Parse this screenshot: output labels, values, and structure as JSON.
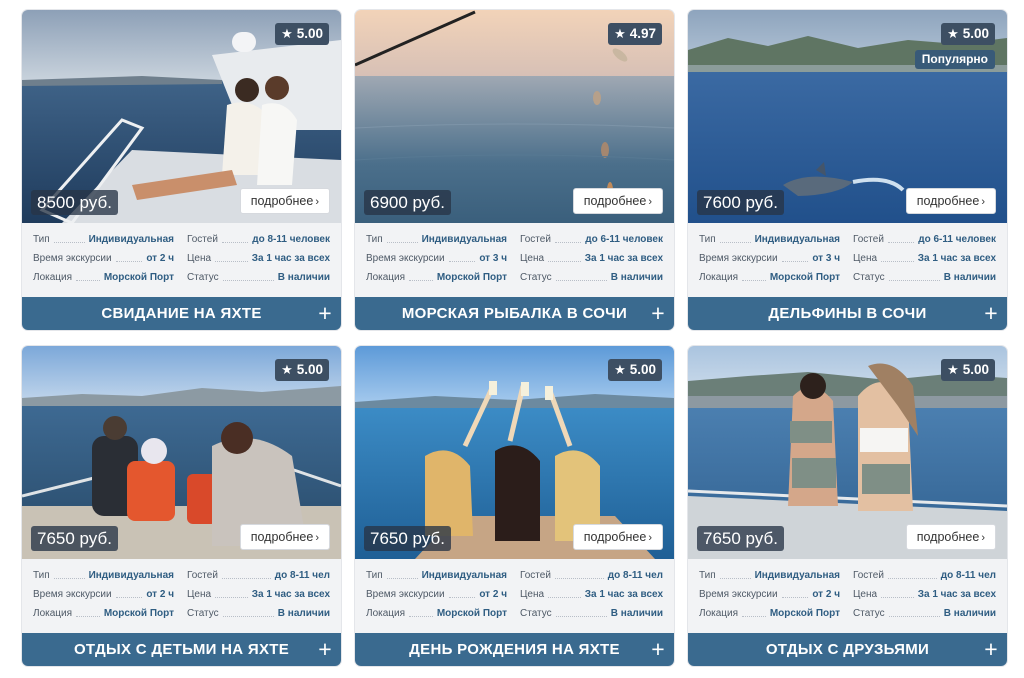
{
  "cards": [
    {
      "rating": "5.00",
      "badge": "",
      "price": "8500 руб.",
      "more": "подробнее",
      "title": "СВИДАНИЕ НА ЯХТЕ",
      "specs": {
        "type_label": "Тип",
        "type_value": "Индивидуальная",
        "guests_label": "Гостей",
        "guests_value": "до 8-11 человек",
        "time_label": "Время экскурсии",
        "time_value": "от 2 ч",
        "price_label": "Цена",
        "price_value": "За 1 час за всех",
        "loc_label": "Локация",
        "loc_value": "Морской Порт",
        "status_label": "Статус",
        "status_value": "В наличии"
      },
      "colors": {
        "sky": "#c8d2dc",
        "sea": "#2d4f78"
      }
    },
    {
      "rating": "4.97",
      "badge": "",
      "price": "6900 руб.",
      "more": "подробнее",
      "title": "МОРСКАЯ РЫБАЛКА В СОЧИ",
      "specs": {
        "type_label": "Тип",
        "type_value": "Индивидуальная",
        "guests_label": "Гостей",
        "guests_value": "до 6-11 человек",
        "time_label": "Время экскурсии",
        "time_value": "от 3 ч",
        "price_label": "Цена",
        "price_value": "За 1 час за всех",
        "loc_label": "Локация",
        "loc_value": "Морской Порт",
        "status_label": "Статус",
        "status_value": "В наличии"
      },
      "colors": {
        "sky": "#e8c8b0",
        "sea": "#5f7f95"
      }
    },
    {
      "rating": "5.00",
      "badge": "Популярно",
      "price": "7600 руб.",
      "more": "подробнее",
      "title": "ДЕЛЬФИНЫ В СОЧИ",
      "specs": {
        "type_label": "Тип",
        "type_value": "Индивидуальная",
        "guests_label": "Гостей",
        "guests_value": "до 6-11 человек",
        "time_label": "Время экскурсии",
        "time_value": "от 3 ч",
        "price_label": "Цена",
        "price_value": "За 1 час за всех",
        "loc_label": "Локация",
        "loc_value": "Морской Порт",
        "status_label": "Статус",
        "status_value": "В наличии"
      },
      "colors": {
        "sky": "#9fb6cc",
        "sea": "#2b5d97"
      }
    },
    {
      "rating": "5.00",
      "badge": "",
      "price": "7650 руб.",
      "more": "подробнее",
      "title": "ОТДЫХ С ДЕТЬМИ НА ЯХТЕ",
      "specs": {
        "type_label": "Тип",
        "type_value": "Индивидуальная",
        "guests_label": "Гостей",
        "guests_value": "до 8-11 чел",
        "time_label": "Время экскурсии",
        "time_value": "от 2 ч",
        "price_label": "Цена",
        "price_value": "За 1 час за всех",
        "loc_label": "Локация",
        "loc_value": "Морской Порт",
        "status_label": "Статус",
        "status_value": "В наличии"
      },
      "colors": {
        "sky": "#9dc1e6",
        "sea": "#33597e"
      }
    },
    {
      "rating": "5.00",
      "badge": "",
      "price": "7650 руб.",
      "more": "подробнее",
      "title": "ДЕНЬ РОЖДЕНИЯ НА ЯХТЕ",
      "specs": {
        "type_label": "Тип",
        "type_value": "Индивидуальная",
        "guests_label": "Гостей",
        "guests_value": "до 8-11 чел",
        "time_label": "Время экскурсии",
        "time_value": "от 2 ч",
        "price_label": "Цена",
        "price_value": "За 1 час за всех",
        "loc_label": "Локация",
        "loc_value": "Морской Порт",
        "status_label": "Статус",
        "status_value": "В наличии"
      },
      "colors": {
        "sky": "#7fb2df",
        "sea": "#2e7db3"
      }
    },
    {
      "rating": "5.00",
      "badge": "",
      "price": "7650 руб.",
      "more": "подробнее",
      "title": "ОТДЫХ С ДРУЗЬЯМИ",
      "specs": {
        "type_label": "Тип",
        "type_value": "Индивидуальная",
        "guests_label": "Гостей",
        "guests_value": "до 8-11 чел",
        "time_label": "Время экскурсии",
        "time_value": "от 2 ч",
        "price_label": "Цена",
        "price_value": "За 1 час за всех",
        "loc_label": "Локация",
        "loc_value": "Морской Порт",
        "status_label": "Статус",
        "status_value": "В наличии"
      },
      "colors": {
        "sky": "#b9cfe3",
        "sea": "#3c6e99"
      }
    }
  ]
}
